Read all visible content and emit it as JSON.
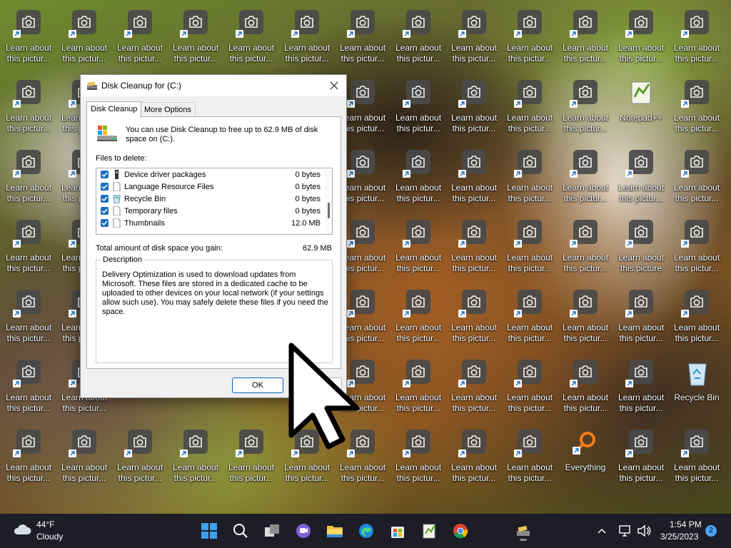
{
  "desktop": {
    "icon_label": "Learn about this picture",
    "icon_label_truncated": "Learn about this pictur...",
    "special_icons": {
      "notepad": "Notepad++",
      "recycle": "Recycle Bin",
      "everything": "Everything"
    }
  },
  "dialog": {
    "title": "Disk Cleanup for  (C:)",
    "tabs": [
      {
        "label": "Disk Cleanup"
      },
      {
        "label": "More Options"
      }
    ],
    "intro": "You can use Disk Cleanup to free up to 62.9 MB of disk space on  (C:).",
    "files_label": "Files to delete:",
    "files": [
      {
        "name": "Device driver packages",
        "size": "0 bytes",
        "checked": true,
        "icon": "device-driver-icon"
      },
      {
        "name": "Language Resource Files",
        "size": "0 bytes",
        "checked": true,
        "icon": "file-icon"
      },
      {
        "name": "Recycle Bin",
        "size": "0 bytes",
        "checked": true,
        "icon": "recycle-bin-icon"
      },
      {
        "name": "Temporary files",
        "size": "0 bytes",
        "checked": true,
        "icon": "file-icon"
      },
      {
        "name": "Thumbnails",
        "size": "12.0 MB",
        "checked": true,
        "icon": "file-icon"
      }
    ],
    "total_label": "Total amount of disk space you gain:",
    "total_value": "62.9 MB",
    "description_legend": "Description",
    "description": "Delivery Optimization is used to download updates from Microsoft. These files are stored in a dedicated cache to be uploaded to other devices on your local network (if your settings allow such use). You may safely delete these files if you need the space.",
    "ok_label": "OK",
    "cancel_label": "Cancel"
  },
  "taskbar": {
    "weather_temp": "44°F",
    "weather_condition": "Cloudy",
    "time": "1:54 PM",
    "date": "3/25/2023",
    "notification_count": "2",
    "apps": [
      "start-icon",
      "search-icon",
      "task-view-icon",
      "chat-icon",
      "file-explorer-icon",
      "edge-icon",
      "store-icon",
      "notepadpp-icon",
      "chrome-icon",
      "disk-cleanup-icon"
    ]
  },
  "colors": {
    "taskbar_bg": "#1c1d26",
    "accent": "#1a6fbf",
    "badge": "#4ca3f4"
  }
}
